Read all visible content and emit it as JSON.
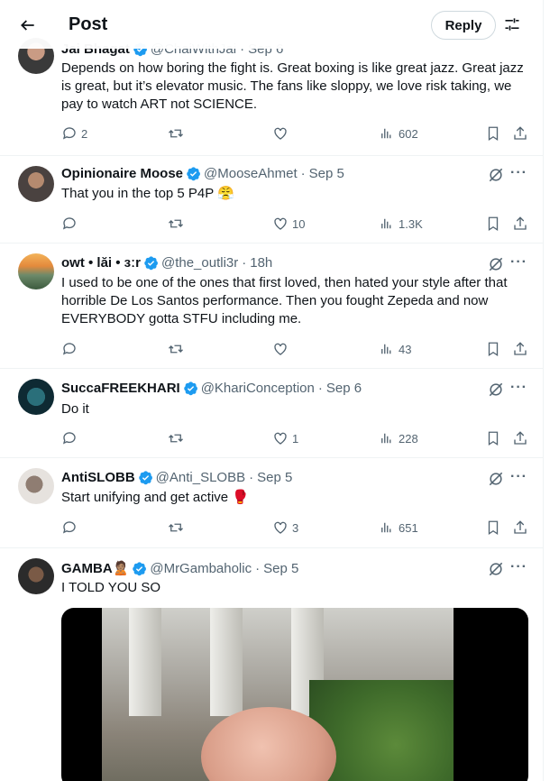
{
  "header": {
    "title": "Post",
    "reply_label": "Reply"
  },
  "colors": {
    "verified": "#1d9bf0",
    "text_secondary": "#536471"
  },
  "tweets": [
    {
      "name": "Jai Bhagat",
      "handle": "@ChaiWithJai",
      "time": "Sep 6",
      "text": "Depends on how boring the fight is. Great boxing is like great jazz. Great jazz is great, but it’s elevator music. The fans like sloppy, we love risk taking, we pay to watch ART not SCIENCE.",
      "replies": "2",
      "reposts": "",
      "likes": "",
      "views": "602"
    },
    {
      "name": "Opinionaire Moose",
      "handle": "@MooseAhmet",
      "time": "Sep 5",
      "text": "That you in the top 5 P4P 😤",
      "replies": "",
      "reposts": "",
      "likes": "10",
      "views": "1.3K"
    },
    {
      "name": "owt • lăi • ɜːr",
      "handle": "@the_outli3r",
      "time": "18h",
      "text": "I used to be one of the ones that first loved, then hated your style after that horrible De Los Santos performance.  Then you fought Zepeda and now EVERYBODY gotta STFU including me.",
      "replies": "",
      "reposts": "",
      "likes": "",
      "views": "43"
    },
    {
      "name": "SuccaFREEKHARI",
      "handle": "@KhariConception",
      "time": "Sep 6",
      "text": "Do it",
      "replies": "",
      "reposts": "",
      "likes": "1",
      "views": "228"
    },
    {
      "name": "AntiSLOBB",
      "handle": "@Anti_SLOBB",
      "time": "Sep 5",
      "text": "Start unifying and get active 🥊",
      "replies": "",
      "reposts": "",
      "likes": "3",
      "views": "651"
    },
    {
      "name": "GAMBA🙎🏽",
      "handle": "@MrGambaholic",
      "time": "Sep 5",
      "text": "I TOLD YOU SO",
      "replies": "",
      "reposts": "",
      "likes": "",
      "views": ""
    }
  ]
}
